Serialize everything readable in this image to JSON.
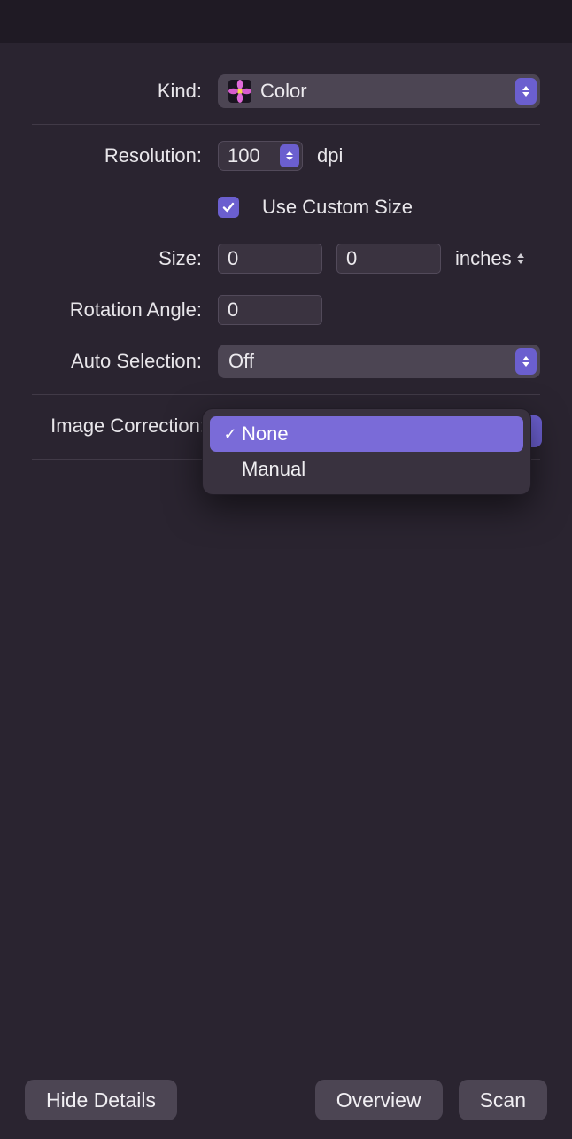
{
  "labels": {
    "kind": "Kind:",
    "resolution": "Resolution:",
    "size": "Size:",
    "rotation": "Rotation Angle:",
    "auto_selection": "Auto Selection:",
    "image_correction": "Image Correction:"
  },
  "kind": {
    "value": "Color"
  },
  "resolution": {
    "value": "100",
    "unit": "dpi"
  },
  "custom_size": {
    "checked": true,
    "label": "Use Custom Size"
  },
  "size": {
    "width": "0",
    "height": "0",
    "unit": "inches"
  },
  "rotation": {
    "value": "0"
  },
  "auto_selection": {
    "value": "Off"
  },
  "image_correction_menu": {
    "options": [
      "None",
      "Manual"
    ],
    "selected": "None"
  },
  "footer": {
    "hide_details": "Hide Details",
    "overview": "Overview",
    "scan": "Scan"
  }
}
